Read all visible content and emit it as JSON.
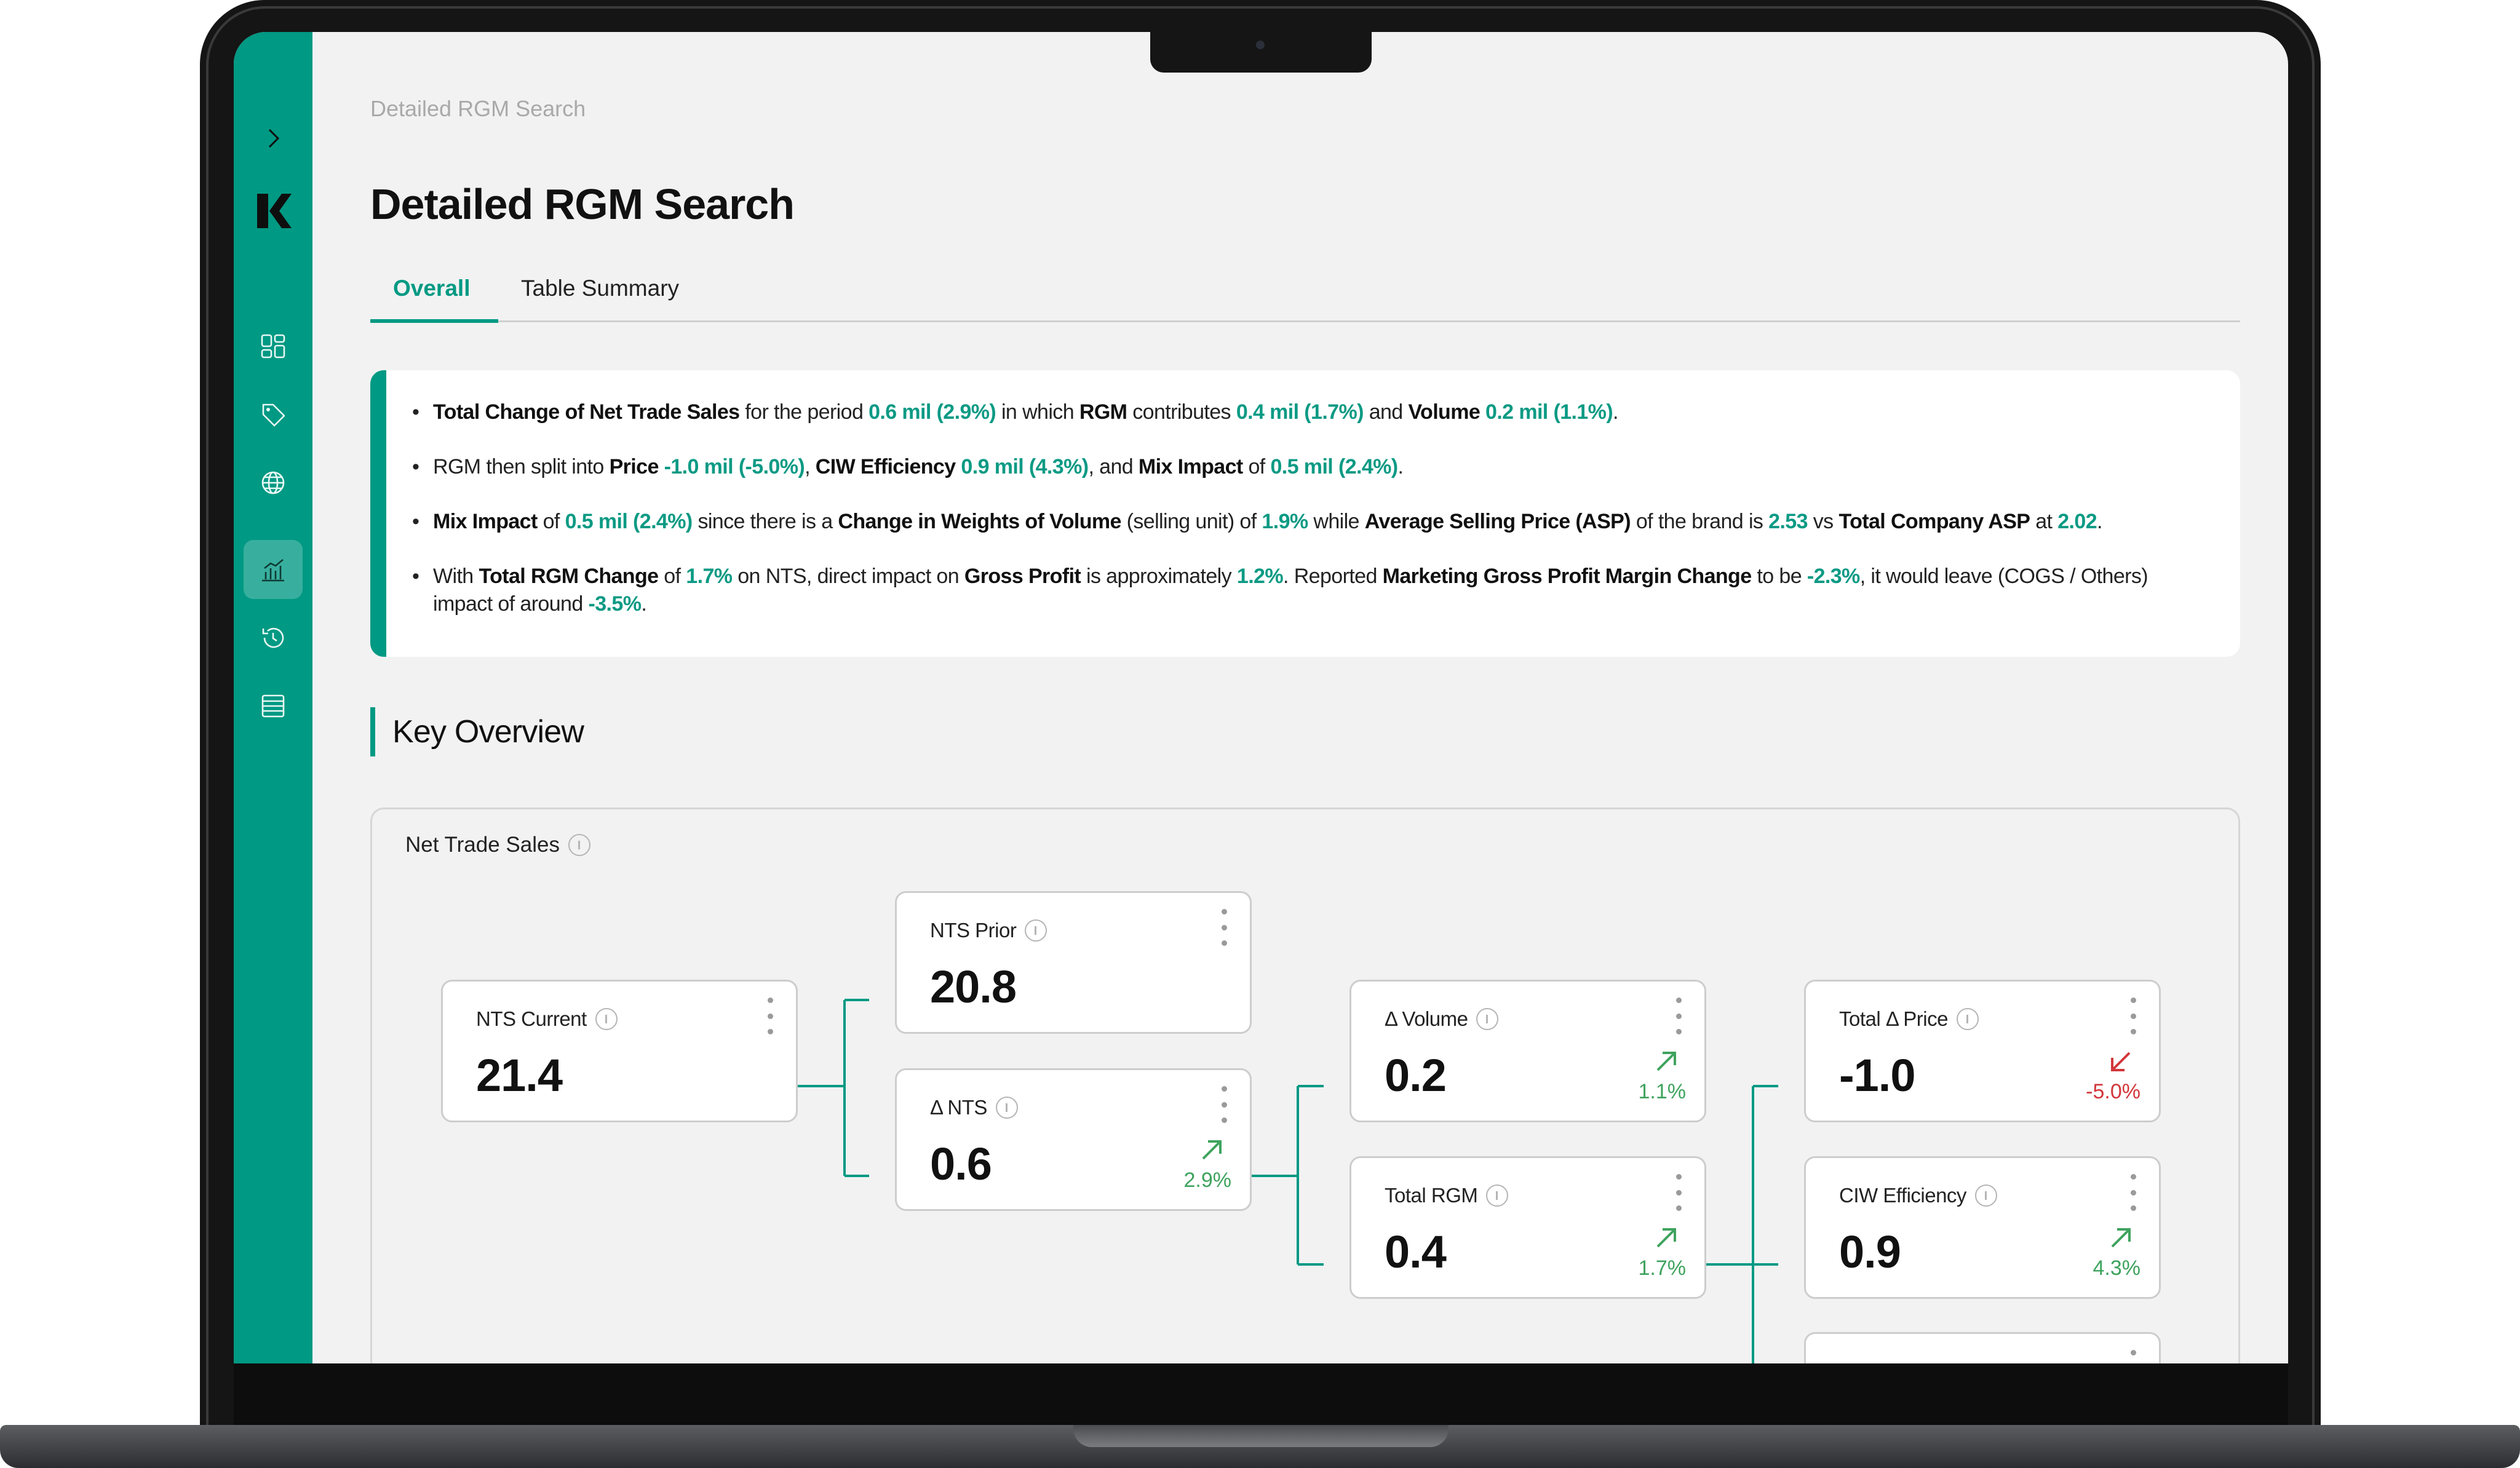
{
  "breadcrumb": "Detailed RGM Search",
  "page_title": "Detailed RGM Search",
  "tabs": [
    {
      "label": "Overall",
      "active": true
    },
    {
      "label": "Table Summary",
      "active": false
    }
  ],
  "summary": {
    "b1": {
      "t1": "Total Change of Net Trade Sales",
      "t2": " for the period ",
      "v1": "0.6 mil (2.9%)",
      "t3": " in which ",
      "t4": "RGM",
      "t5": " contributes ",
      "v2": "0.4 mil (1.7%)",
      "t6": " and ",
      "t7": "Volume",
      "t8": " ",
      "v3": "0.2 mil (1.1%)",
      "t9": "."
    },
    "b2": {
      "t1": "RGM then split into ",
      "t2": "Price",
      "t3": " ",
      "v1": "-1.0 mil (-5.0%)",
      "t4": ", ",
      "t5": "CIW Efficiency",
      "t6": " ",
      "v2": "0.9 mil (4.3%)",
      "t7": ", and ",
      "t8": "Mix Impact",
      "t9": " of ",
      "v3": "0.5 mil (2.4%)",
      "t10": "."
    },
    "b3": {
      "t1": "Mix Impact",
      "t2": " of ",
      "v1": "0.5 mil (2.4%)",
      "t3": " since there is a ",
      "t4": "Change in Weights of Volume",
      "t5": " (selling unit) of ",
      "v2": "1.9%",
      "t6": " while ",
      "t7": "Average Selling Price (ASP)",
      "t8": " of the brand is ",
      "v3": "2.53",
      "t9": " vs ",
      "t10": "Total Company ASP",
      "t11": " at ",
      "v4": "2.02",
      "t12": "."
    },
    "b4": {
      "t1": "With ",
      "t2": "Total RGM Change",
      "t3": " of ",
      "v1": "1.7%",
      "t4": " on NTS, direct impact on ",
      "t5": "Gross Profit",
      "t6": " is approximately ",
      "v2": "1.2%",
      "t7": ". Reported ",
      "t8": "Marketing Gross Profit Margin Change",
      "t9": " to be ",
      "v3": "-2.3%",
      "t10": ", it would leave (COGS / Others) impact of around ",
      "v4": "-3.5%",
      "t11": "."
    }
  },
  "key_overview": {
    "title": "Key Overview",
    "panel_label": "Net Trade Sales",
    "nodes": {
      "nts_current": {
        "label": "NTS Current",
        "value": "21.4"
      },
      "nts_prior": {
        "label": "NTS Prior",
        "value": "20.8"
      },
      "delta_nts": {
        "label": "Δ NTS",
        "value": "0.6",
        "change": "2.9%",
        "direction": "up"
      },
      "delta_volume": {
        "label": "Δ Volume",
        "value": "0.2",
        "change": "1.1%",
        "direction": "up"
      },
      "total_rgm": {
        "label": "Total RGM",
        "value": "0.4",
        "change": "1.7%",
        "direction": "up"
      },
      "total_delta_price": {
        "label": "Total Δ Price",
        "value": "-1.0",
        "change": "-5.0%",
        "direction": "down"
      },
      "ciw_efficiency": {
        "label": "CIW Efficiency",
        "value": "0.9",
        "change": "4.3%",
        "direction": "up"
      }
    }
  },
  "colors": {
    "accent": "#009983",
    "positive": "#3fa35e",
    "negative": "#d2373b",
    "highlight_text": "#0b9a84"
  },
  "icons": {
    "sidebar": [
      "chevron-right-icon",
      "brand-logo",
      "dashboard-icon",
      "tag-icon",
      "globe-icon",
      "chart-icon",
      "history-icon",
      "table-icon"
    ],
    "node": [
      "info-icon",
      "more-vertical-icon",
      "trend-up-icon",
      "trend-down-icon"
    ]
  }
}
